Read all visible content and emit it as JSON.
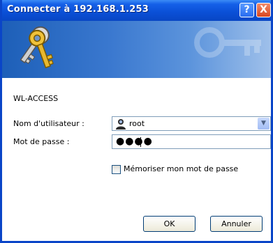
{
  "window": {
    "title": "Connecter à 192.168.1.253",
    "help_label": "?",
    "close_label": "X"
  },
  "realm": "WL-ACCESS",
  "form": {
    "username_label": "Nom d'utilisateur :",
    "username_value": "root",
    "password_label": "Mot de passe :",
    "password_masked": "●●●●",
    "remember_label": "Mémoriser mon mot de passe",
    "remember_checked": false
  },
  "buttons": {
    "ok": "OK",
    "cancel": "Annuler"
  },
  "colors": {
    "titlebar": "#0a4fd6",
    "banner": "#3a78cf",
    "dialog_bg": "#ffffff"
  }
}
